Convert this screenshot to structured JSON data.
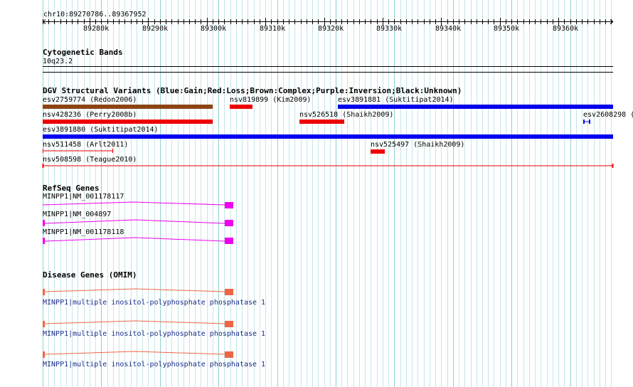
{
  "ruler": {
    "range_label": "chr10:89270786..89367952",
    "ticks": [
      "89280k",
      "89290k",
      "89300k",
      "89310k",
      "89320k",
      "89330k",
      "89340k",
      "89350k",
      "89360k"
    ]
  },
  "tracks": {
    "cytobands": {
      "title": "Cytogenetic Bands",
      "label": "10q23.2"
    },
    "dgv": {
      "title": "DGV Structural Variants (Blue:Gain;Red:Loss;Brown:Complex;Purple:Inversion;Black:Unknown)",
      "colors": {
        "gain": "#0000ee",
        "loss": "#ee0000",
        "complex": "#8b4513"
      },
      "variants": [
        {
          "label": "esv2759774 (Redon2006)",
          "type": "complex"
        },
        {
          "label": "nsv819899 (Kim2009)",
          "type": "loss"
        },
        {
          "label": "esv3891881 (Suktitipat2014)",
          "type": "gain"
        },
        {
          "label": "nsv428236 (Perry2008b)",
          "type": "loss"
        },
        {
          "label": "nsv526518 (Shaikh2009)",
          "type": "loss"
        },
        {
          "label": "esv2608298 (",
          "type": "gain"
        },
        {
          "label": "esv3891880 (Suktitipat2014)",
          "type": "gain"
        },
        {
          "label": "nsv511458 (Arlt2011)",
          "type": "loss"
        },
        {
          "label": "nsv525497 (Shaikh2009)",
          "type": "loss"
        },
        {
          "label": "nsv508598 (Teague2010)",
          "type": "loss"
        }
      ]
    },
    "refseq": {
      "title": "RefSeq Genes",
      "color": "#ee00ee",
      "transcripts": [
        "MINPP1|NM_001178117",
        "MINPP1|NM_004897",
        "MINPP1|NM_001178118"
      ]
    },
    "omim": {
      "title": "Disease Genes (OMIM)",
      "color": "#ee6644",
      "entries": [
        "MINPP1|multiple inositol-polyphosphate phosphatase 1",
        "MINPP1|multiple inositol-polyphosphate phosphatase 1",
        "MINPP1|multiple inositol-polyphosphate phosphatase 1"
      ]
    }
  }
}
